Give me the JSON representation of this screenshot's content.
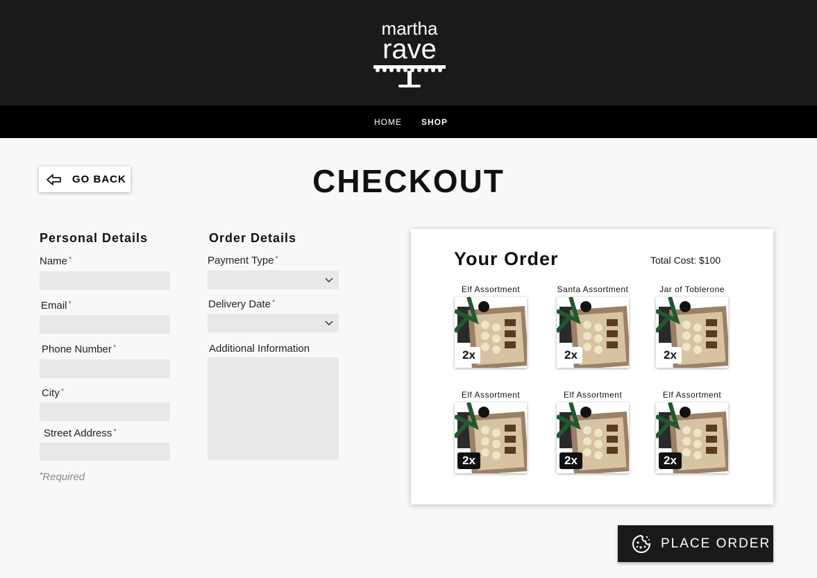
{
  "brand": {
    "line1": "martha",
    "line2": "rave"
  },
  "nav": {
    "home": "HOME",
    "shop": "SHOP"
  },
  "go_back": "GO BACK",
  "title": "CHECKOUT",
  "personal": {
    "heading": "Personal Details",
    "fields": [
      {
        "label": "Name",
        "required": "*"
      },
      {
        "label": "Email",
        "required": "*"
      },
      {
        "label": "Phone Number",
        "required": "*"
      },
      {
        "label": "City",
        "required": "*"
      },
      {
        "label": "Street Address",
        "required": "*"
      }
    ]
  },
  "orderDetails": {
    "heading": "Order Details",
    "payment": {
      "label": "Payment Type",
      "required": "*"
    },
    "delivery": {
      "label": "Delivery Date",
      "required": "*"
    },
    "additional": {
      "label": "Additional Information"
    }
  },
  "required_note": {
    "mark": "*",
    "text": "Required"
  },
  "order": {
    "title": "Your Order",
    "total": "Total Cost: $100",
    "items": [
      {
        "name": "Elf Assortment",
        "qty": "2x"
      },
      {
        "name": "Santa Assortment",
        "qty": "2x"
      },
      {
        "name": "Jar of Toblerone",
        "qty": "2x"
      },
      {
        "name": "Elf Assortment",
        "qty": "2x"
      },
      {
        "name": "Elf Assortment",
        "qty": "2x"
      },
      {
        "name": "Elf Assortment",
        "qty": "2x"
      }
    ]
  },
  "place_order": "PLACE ORDER"
}
